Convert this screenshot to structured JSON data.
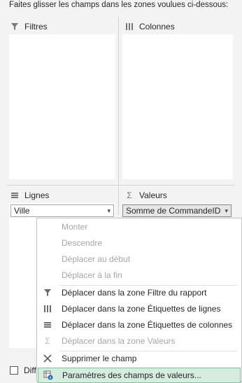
{
  "instruction": "Faites glisser les champs dans les zones voulues ci-dessous:",
  "zones": {
    "filters": {
      "label": "Filtres",
      "icon": "filter-icon"
    },
    "columns": {
      "label": "Colonnes",
      "icon": "columns-icon"
    },
    "rows": {
      "label": "Lignes",
      "icon": "rows-icon",
      "field": "Ville"
    },
    "values": {
      "label": "Valeurs",
      "icon": "sigma-icon",
      "field": "Somme de CommandeID"
    }
  },
  "bottom": {
    "label": "Diff"
  },
  "menu": {
    "items": [
      {
        "label": "Monter",
        "underline": "M",
        "enabled": false,
        "icon": ""
      },
      {
        "label": "Descendre",
        "underline": "n",
        "enabled": false,
        "icon": ""
      },
      {
        "label": "Déplacer au début",
        "underline": "b",
        "enabled": false,
        "icon": ""
      },
      {
        "label": "Déplacer à la fin",
        "underline": "D",
        "enabled": false,
        "icon": ""
      },
      {
        "label": "Déplacer dans la zone Filtre du rapport",
        "enabled": true,
        "icon": "filter-icon"
      },
      {
        "label": "Déplacer dans la zone Étiquettes de lignes",
        "enabled": true,
        "icon": "columns-icon"
      },
      {
        "label": "Déplacer dans la zone Étiquettes de colonnes",
        "enabled": true,
        "icon": "rows-icon"
      },
      {
        "label": "Déplacer dans la zone Valeurs",
        "enabled": false,
        "icon": "sigma-icon"
      },
      {
        "label": "Supprimer le champ",
        "enabled": true,
        "icon": "close-icon"
      },
      {
        "label": "Paramètres des champs de valeurs...",
        "enabled": true,
        "icon": "field-settings-icon",
        "highlighted": true
      }
    ]
  }
}
